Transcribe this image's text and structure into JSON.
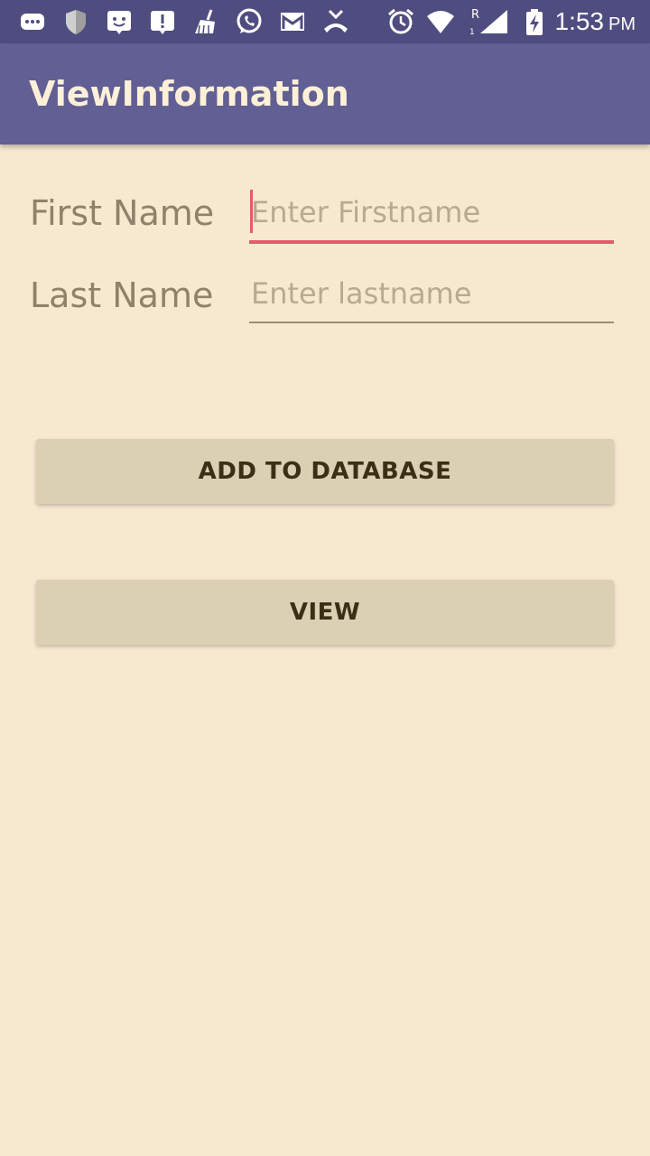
{
  "status_bar": {
    "time": "1:53",
    "ampm": "PM",
    "network_label": "R",
    "sim_label": "1",
    "icons": [
      "chat-bubble-icon",
      "shield-icon",
      "face-badge-icon",
      "alert-icon",
      "broom-icon",
      "whatsapp-icon",
      "gmail-icon",
      "missed-call-icon",
      "alarm-icon",
      "wifi-icon",
      "signal-icon",
      "battery-charging-icon"
    ]
  },
  "app_bar": {
    "title": "ViewInformation"
  },
  "form": {
    "first_name": {
      "label": "First Name",
      "placeholder": "Enter Firstname",
      "value": ""
    },
    "last_name": {
      "label": "Last Name",
      "placeholder": "Enter lastname",
      "value": ""
    }
  },
  "buttons": {
    "add": "ADD TO DATABASE",
    "view": "VIEW"
  },
  "colors": {
    "status_bar": "#4f4c80",
    "app_bar": "#615f93",
    "background": "#f7e9d0",
    "focus_accent": "#e85a6a",
    "button": "#dbd0b3"
  }
}
